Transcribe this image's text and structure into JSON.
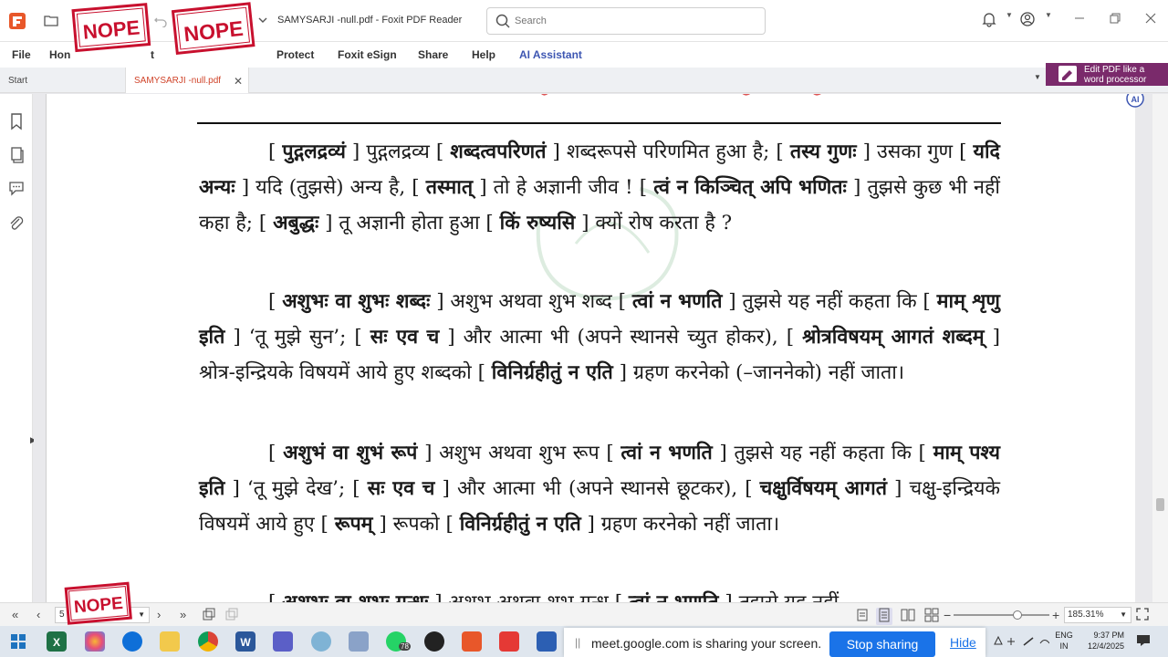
{
  "window": {
    "title": "SAMYSARJI -null.pdf - Foxit PDF Reader",
    "search_placeholder": "Search"
  },
  "menu": {
    "file": "File",
    "home": "Hon",
    "protect": "Protect",
    "esign": "Foxit eSign",
    "share": "Share",
    "help": "Help",
    "ai_assistant": "AI Assistant",
    "hidden_suffix": "t"
  },
  "tabs": {
    "start": "Start",
    "document": "SAMYSARJI -null.pdf"
  },
  "promo": {
    "line1": "Edit PDF like a",
    "line2": "word processor"
  },
  "stamps": {
    "label": "NOPE"
  },
  "document": {
    "paragraphs": [
      {
        "id": "p1",
        "segments": [
          {
            "t": "[",
            "b": false
          },
          {
            "t": "पुद्गलद्रव्यं",
            "b": true
          },
          {
            "t": "] पुद्गलद्रव्य [",
            "b": false
          },
          {
            "t": "शब्दत्वपरिणतं",
            "b": true
          },
          {
            "t": "] शब्दरूपसे परिणमित हुआ है; [",
            "b": false
          },
          {
            "t": "तस्य गुणः",
            "b": true
          },
          {
            "t": "] उसका गुण [",
            "b": false
          },
          {
            "t": "यदि अन्यः",
            "b": true
          },
          {
            "t": "] यदि (तुझसे) अन्य है, [",
            "b": false
          },
          {
            "t": "तस्मात्",
            "b": true
          },
          {
            "t": "] तो हे अज्ञानी जीव ! [",
            "b": false
          },
          {
            "t": "त्वं न किञ्चित् अपि भणितः",
            "b": true
          },
          {
            "t": "] तुझसे कुछ भी नहीं कहा है; [",
            "b": false
          },
          {
            "t": "अबुद्धः",
            "b": true
          },
          {
            "t": "] तू अज्ञानी होता हुआ [",
            "b": false
          },
          {
            "t": "किं रुष्यसि",
            "b": true
          },
          {
            "t": "] क्यों रोष करता है ?",
            "b": false
          }
        ]
      },
      {
        "id": "p2",
        "segments": [
          {
            "t": "[",
            "b": false
          },
          {
            "t": "अशुभः वा शुभः शब्दः",
            "b": true
          },
          {
            "t": "] अशुभ अथवा शुभ शब्द [",
            "b": false
          },
          {
            "t": "त्वां न भणति",
            "b": true
          },
          {
            "t": "] तुझसे यह नहीं कहता कि [",
            "b": false
          },
          {
            "t": "माम् शृणु इति",
            "b": true
          },
          {
            "t": "] ‘तू मुझे सुन’; [",
            "b": false
          },
          {
            "t": "सः एव च",
            "b": true
          },
          {
            "t": "] और आत्मा भी (अपने स्थानसे च्युत होकर), [",
            "b": false
          },
          {
            "t": "श्रोत्रविषयम् आगतं शब्दम्",
            "b": true
          },
          {
            "t": "] श्रोत्र-इन्द्रियके विषयमें आये हुए शब्दको [",
            "b": false
          },
          {
            "t": "विनिर्ग्रहीतुं न एति",
            "b": true
          },
          {
            "t": "] ग्रहण करनेको (–जाननेको) नहीं जाता।",
            "b": false
          }
        ]
      },
      {
        "id": "p3",
        "segments": [
          {
            "t": "[",
            "b": false
          },
          {
            "t": "अशुभं वा शुभं रूपं",
            "b": true
          },
          {
            "t": "] अशुभ अथवा शुभ रूप [",
            "b": false
          },
          {
            "t": "त्वां न भणति",
            "b": true
          },
          {
            "t": "] तुझसे यह नहीं कहता कि [",
            "b": false
          },
          {
            "t": "माम् पश्य इति",
            "b": true
          },
          {
            "t": "] ‘तू मुझे देख’; [",
            "b": false
          },
          {
            "t": "सः एव च",
            "b": true
          },
          {
            "t": "] और आत्मा भी (अपने स्थानसे छूटकर), [",
            "b": false
          },
          {
            "t": "चक्षुर्विषयम् आगतं",
            "b": true
          },
          {
            "t": "] चक्षु-इन्द्रियके विषयमें आये हुए [",
            "b": false
          },
          {
            "t": "रूपम्",
            "b": true
          },
          {
            "t": "] रूपको [",
            "b": false
          },
          {
            "t": "विनिर्ग्रहीतुं न एति",
            "b": true
          },
          {
            "t": "] ग्रहण करनेको नहीं जाता।",
            "b": false
          }
        ]
      },
      {
        "id": "p4",
        "segments": [
          {
            "t": "[",
            "b": false
          },
          {
            "t": "अशुभः वा शुभः गन्धः",
            "b": true
          },
          {
            "t": "] अशुभ अथवा शुभ गन्ध [",
            "b": false
          },
          {
            "t": "त्वां न भणति",
            "b": true
          },
          {
            "t": "] तुझसे यह नहीं",
            "b": false
          }
        ]
      }
    ]
  },
  "statusbar": {
    "page_value": "5",
    "zoom": "185.31%",
    "zoom_fraction": 0.7
  },
  "share_bar": {
    "message": "meet.google.com is sharing your screen.",
    "stop": "Stop sharing",
    "hide": "Hide"
  },
  "tray": {
    "lang1": "ENG",
    "lang2": "IN",
    "time": "9:37 PM",
    "date": "12/4/2025",
    "whatsapp_badge": "78"
  },
  "colors": {
    "accent": "#e8572a",
    "ai": "#3d56b2",
    "promo_bg": "#7a2a6b",
    "stop_btn": "#1a73e8",
    "stamp": "#c8102e"
  }
}
